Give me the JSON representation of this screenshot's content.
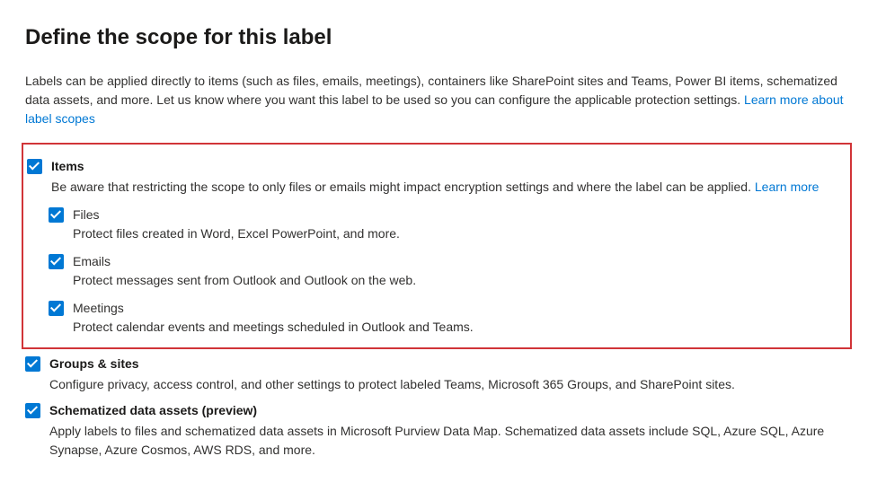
{
  "heading": "Define the scope for this label",
  "intro": {
    "text": "Labels can be applied directly to items (such as files, emails, meetings), containers like SharePoint sites and Teams, Power BI items, schematized data assets, and more. Let us know where you want this label to be used so you can configure the applicable protection settings. ",
    "link": "Learn more about label scopes"
  },
  "items": {
    "label": "Items",
    "desc": "Be aware that restricting the scope to only files or emails might impact encryption settings and where the label can be applied. ",
    "learnMore": "Learn more",
    "subs": [
      {
        "label": "Files",
        "desc": "Protect files created in Word, Excel PowerPoint, and more."
      },
      {
        "label": "Emails",
        "desc": "Protect messages sent from Outlook and Outlook on the web."
      },
      {
        "label": "Meetings",
        "desc": "Protect calendar events and meetings scheduled in Outlook and Teams."
      }
    ]
  },
  "groups": {
    "label": "Groups & sites",
    "desc": "Configure privacy, access control, and other settings to protect labeled Teams, Microsoft 365 Groups, and SharePoint sites."
  },
  "schematized": {
    "label": "Schematized data assets (preview)",
    "desc": "Apply labels to files and schematized data assets in Microsoft Purview Data Map. Schematized data assets include SQL, Azure SQL, Azure Synapse, Azure Cosmos, AWS RDS, and more."
  }
}
